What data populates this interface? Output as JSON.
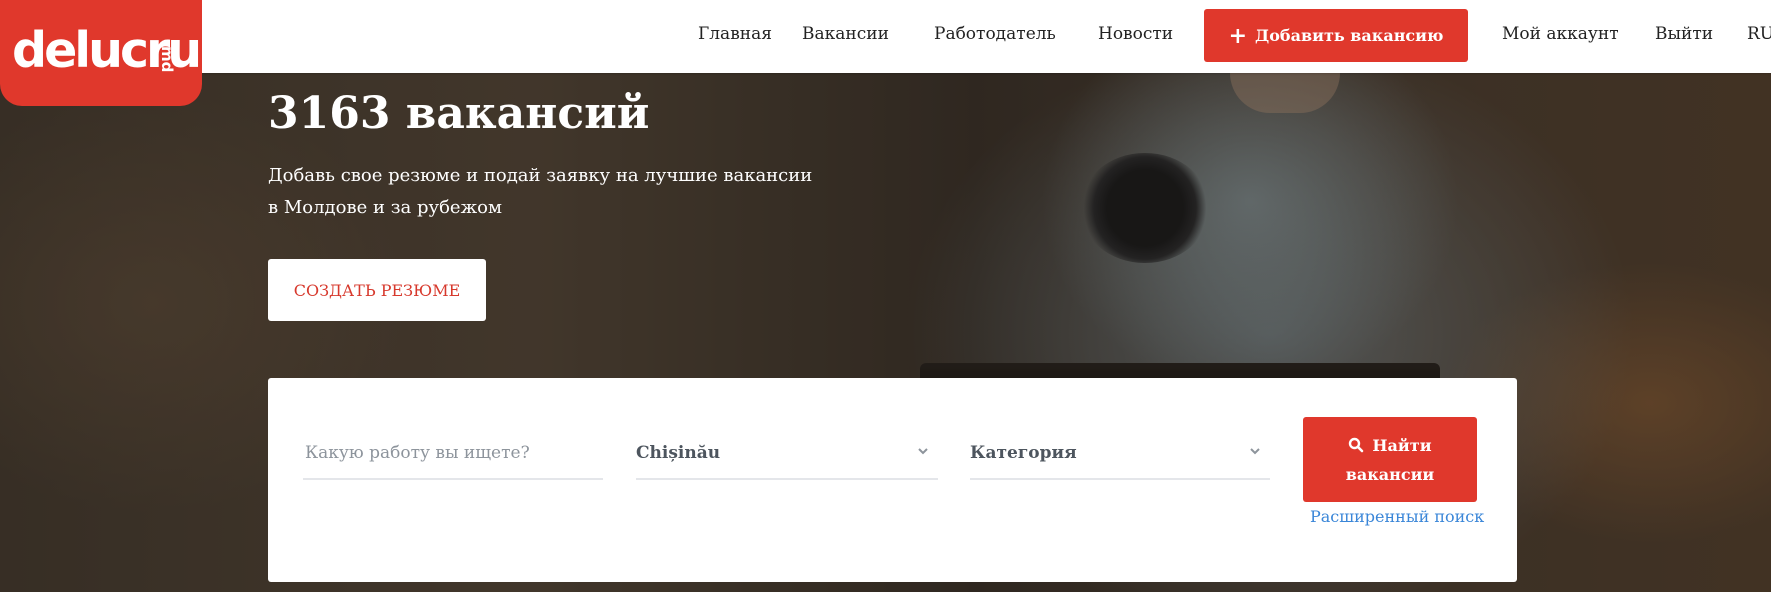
{
  "logo": {
    "text": "delucru",
    "sub": "md"
  },
  "nav": {
    "home": "Главная",
    "vacancies": "Вакансии",
    "employer": "Работодатель",
    "news": "Новости",
    "add_vacancy": "Добавить вакансию",
    "account": "Мой аккаунт",
    "logout": "Выйти",
    "lang": "RU"
  },
  "hero": {
    "title": "3163 вакансий",
    "subtitle": "Добавь свое резюме и подай заявку на лучшие вакансии в Молдове и за рубежом",
    "cv_button": "СОЗДАТЬ РЕЗЮМЕ"
  },
  "search": {
    "keyword_placeholder": "Какую работу вы ищете?",
    "city": "Chișinău",
    "category": "Категория",
    "find_line1": "Найти",
    "find_line2": "вакансии",
    "advanced": "Расширенный поиск"
  },
  "colors": {
    "accent": "#e0382c",
    "link": "#3a86d8"
  },
  "icons": [
    "plus-icon",
    "search-icon",
    "chevron-down-icon"
  ]
}
